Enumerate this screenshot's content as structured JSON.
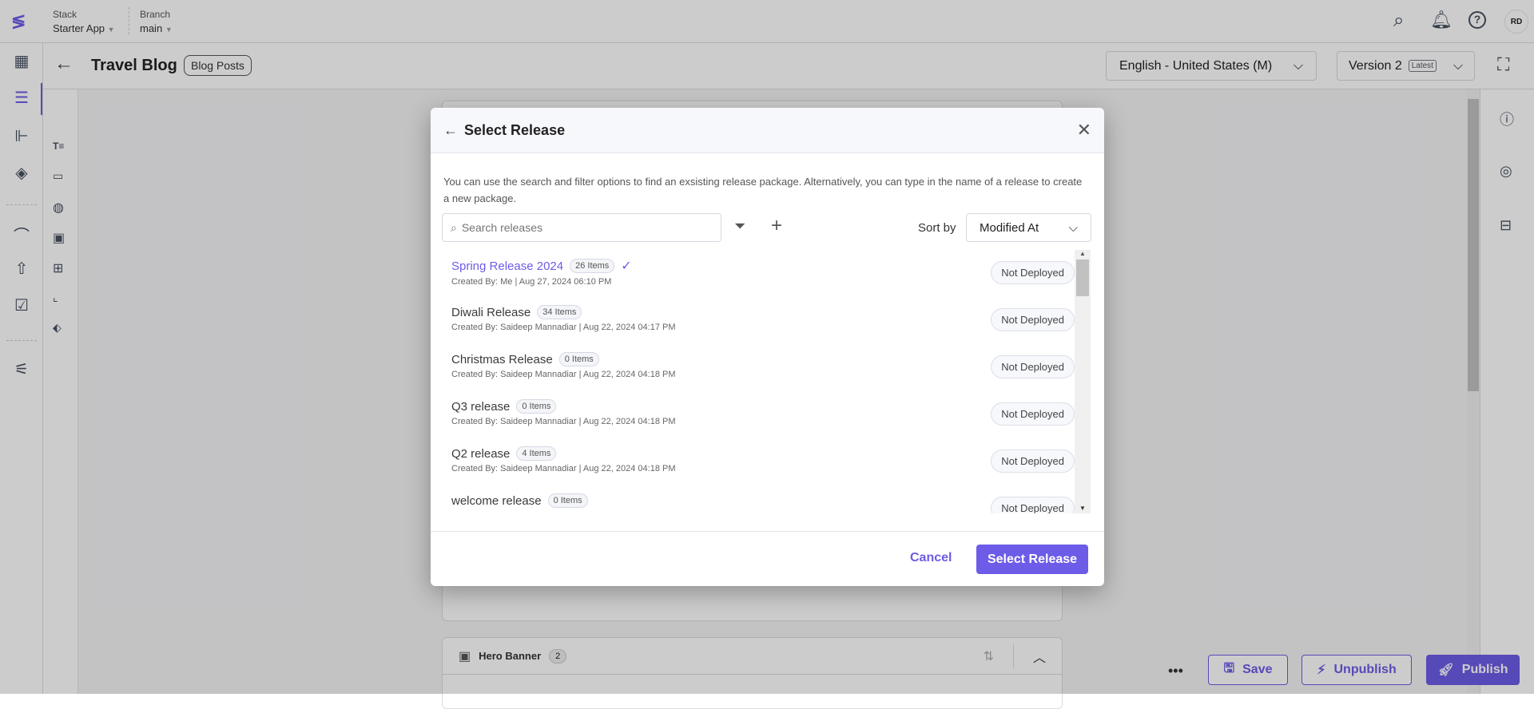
{
  "topbar": {
    "stack_label": "Stack",
    "stack_value": "Starter App",
    "branch_label": "Branch",
    "branch_value": "main",
    "avatar": "RD"
  },
  "header": {
    "title": "Travel Blog",
    "content_type": "Blog Posts",
    "locale": "English - United States (M)",
    "version": "Version 2",
    "version_badge": "Latest"
  },
  "background": {
    "hero_banner_label": "Hero Banner",
    "hero_banner_count": "2"
  },
  "footer": {
    "save": "Save",
    "unpublish": "Unpublish",
    "publish": "Publish"
  },
  "dialog": {
    "title": "Select Release",
    "description": "You can use the search and filter options to find an exsisting release package. Alternatively, you can type in the name of a release to create a new package.",
    "search_placeholder": "Search releases",
    "sort_label": "Sort by",
    "sort_value": "Modified At",
    "releases": [
      {
        "name": "Spring Release 2024",
        "items": "26 Items",
        "meta": "Created By: Me | Aug 27, 2024 06:10 PM",
        "status": "Not Deployed",
        "selected": true
      },
      {
        "name": "Diwali Release",
        "items": "34 Items",
        "meta": "Created By: Saideep Mannadiar | Aug 22, 2024 04:17 PM",
        "status": "Not Deployed"
      },
      {
        "name": "Christmas Release",
        "items": "0 Items",
        "meta": "Created By: Saideep Mannadiar | Aug 22, 2024 04:18 PM",
        "status": "Not Deployed"
      },
      {
        "name": "Q3 release",
        "items": "0 Items",
        "meta": "Created By: Saideep Mannadiar | Aug 22, 2024 04:18 PM",
        "status": "Not Deployed"
      },
      {
        "name": "Q2 release",
        "items": "4 Items",
        "meta": "Created By: Saideep Mannadiar | Aug 22, 2024 04:18 PM",
        "status": "Not Deployed"
      },
      {
        "name": "welcome release",
        "items": "0 Items",
        "meta": "",
        "status": "Not Deployed"
      }
    ],
    "cancel": "Cancel",
    "confirm": "Select Release"
  },
  "colors": {
    "accent": "#6c5ce7",
    "selected_text": "#6c5ce7"
  }
}
